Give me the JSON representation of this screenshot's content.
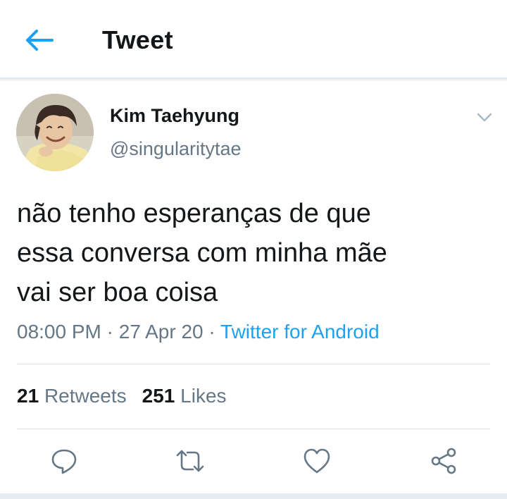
{
  "header": {
    "title": "Tweet"
  },
  "user": {
    "name": "Kim Taehyung",
    "handle": "@singularitytae"
  },
  "tweet": {
    "lines": [
      "não tenho esperanças de que",
      "essa conversa com minha mãe",
      "vai ser boa coisa"
    ],
    "time": "08:00 PM",
    "sep1": " · ",
    "date": "27 Apr 20",
    "sep2": " · ",
    "source": "Twitter for Android"
  },
  "stats": {
    "retweets_count": "21",
    "retweets_label": "Retweets",
    "likes_count": "251",
    "likes_label": "Likes"
  },
  "colors": {
    "accent": "#1da1f2",
    "secondary": "#657786",
    "icon": "#657786",
    "text": "#14171a"
  },
  "icons": {
    "back": "arrow-left",
    "more": "chevron-down",
    "reply": "speech-bubble",
    "retweet": "retweet-arrows",
    "like": "heart-outline",
    "share": "share-nodes"
  }
}
